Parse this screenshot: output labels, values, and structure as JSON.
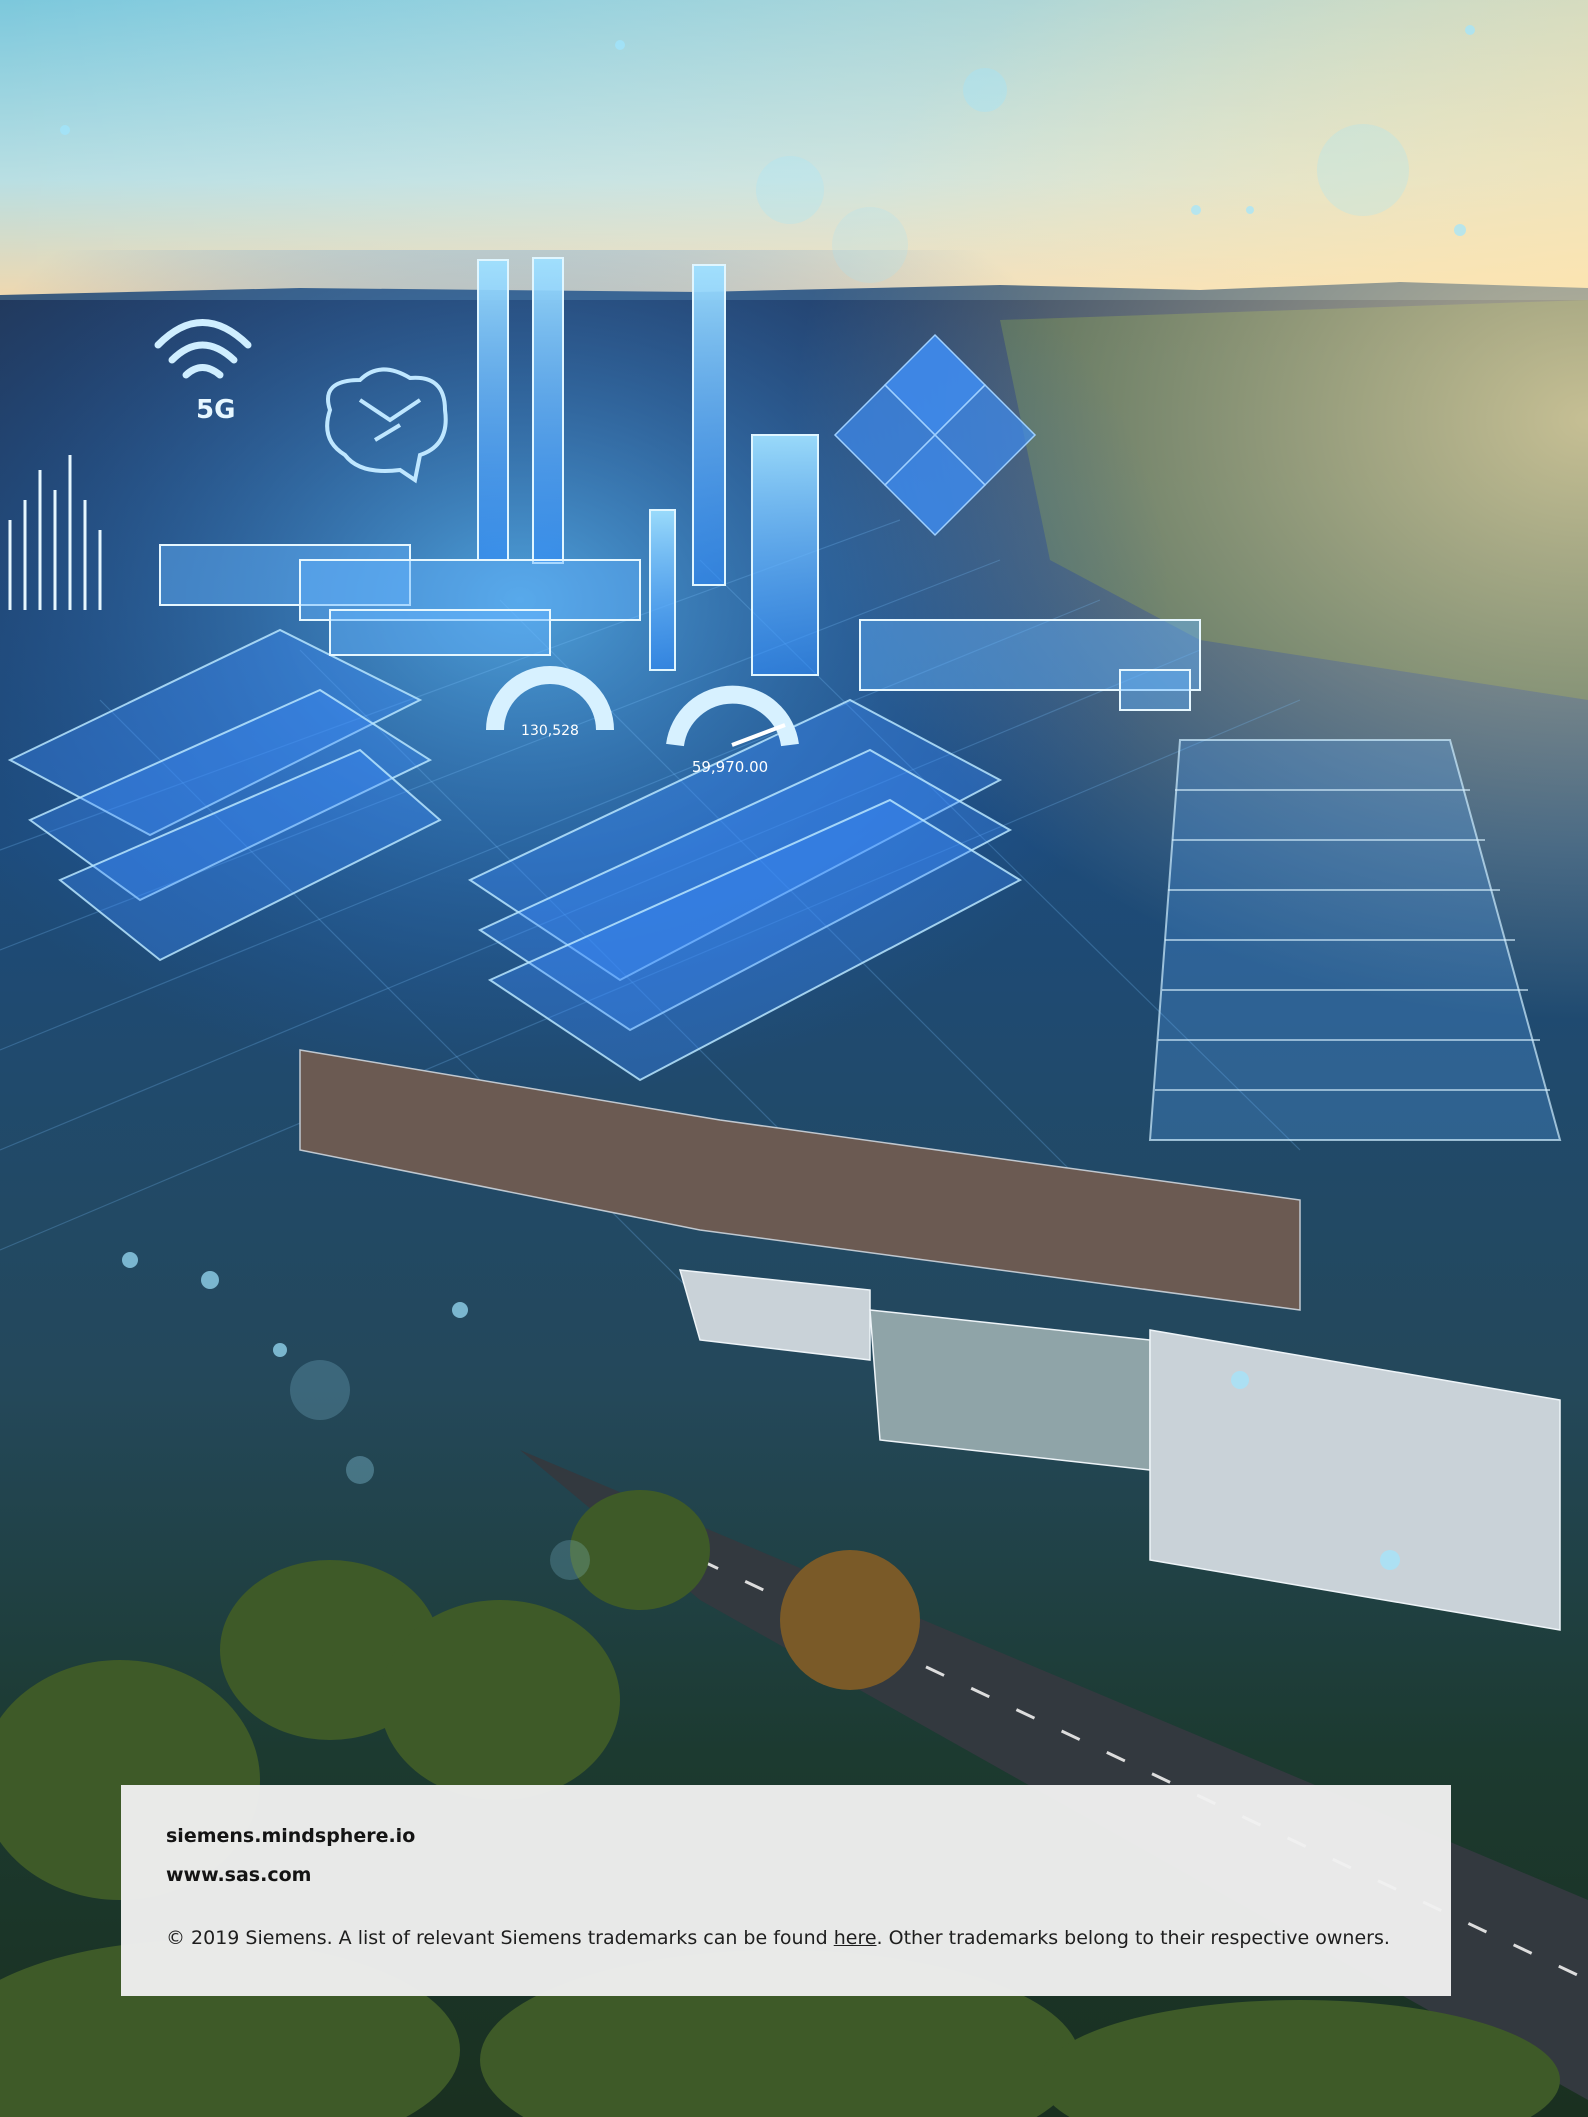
{
  "footer": {
    "link_1": "siemens.mindsphere.io",
    "link_2": "www.sas.com",
    "copyright_prefix": "© 2019 Siemens.  A list of relevant Siemens trademarks can be found ",
    "here_link": "here",
    "copyright_suffix": ". Other trademarks belong to their respective owners."
  },
  "overlay": {
    "network_label": "5G",
    "gauge_1_value": "130,528",
    "gauge_2_value": "59,970.00"
  },
  "colors": {
    "sky_top": "#8fd0e0",
    "sky_horizon": "#f0d9b0",
    "hologram_blue": "#3aa0ff",
    "panel_bg": "#f0f0f0"
  }
}
